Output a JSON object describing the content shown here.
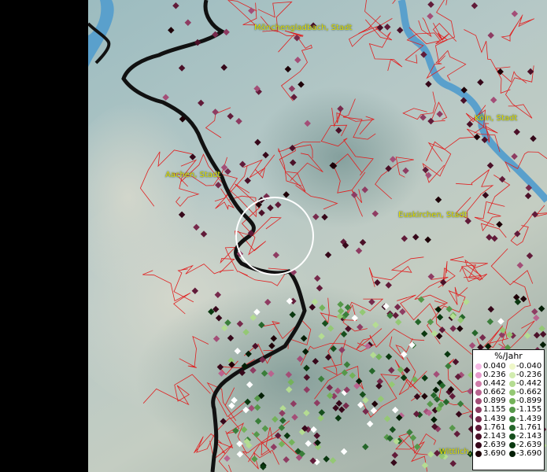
{
  "cities": [
    {
      "name": "Mönchengladbach, Stadt",
      "key": "mg"
    },
    {
      "name": "Köln, Stadt",
      "key": "koeln"
    },
    {
      "name": "Aachen, Stadt",
      "key": "aachen"
    },
    {
      "name": "Euskirchen, Stadt",
      "key": "eusk"
    },
    {
      "name": "Wittlich,",
      "key": "wittlich"
    }
  ],
  "legend": {
    "title": "%/Jahr",
    "positive": [
      "0.040",
      "0.236",
      "0.442",
      "0.662",
      "0.899",
      "1.155",
      "1.439",
      "1.761",
      "2.143",
      "2.639",
      "3.690"
    ],
    "negative": [
      "-0.040",
      "-0.236",
      "-0.442",
      "-0.662",
      "-0.899",
      "-1.155",
      "-1.439",
      "-1.761",
      "-2.143",
      "-2.639",
      "-3.690"
    ],
    "positive_colors": [
      "#f4b8e4",
      "#e49acb",
      "#cf7ca9",
      "#b9648f",
      "#a34e77",
      "#8e3c62",
      "#772a4c",
      "#611b39",
      "#4b1028",
      "#36081a",
      "#1e0208"
    ],
    "negative_colors": [
      "#eef7c8",
      "#d2ecb0",
      "#b4dc92",
      "#94c874",
      "#74b25a",
      "#56984a",
      "#3a7e3a",
      "#25662a",
      "#164e1c",
      "#0a3810",
      "#031e05"
    ]
  },
  "colors": {
    "water": "#5aa0cc",
    "border_line": "#e02020",
    "country_border": "#111111",
    "label": "#e8e000"
  }
}
